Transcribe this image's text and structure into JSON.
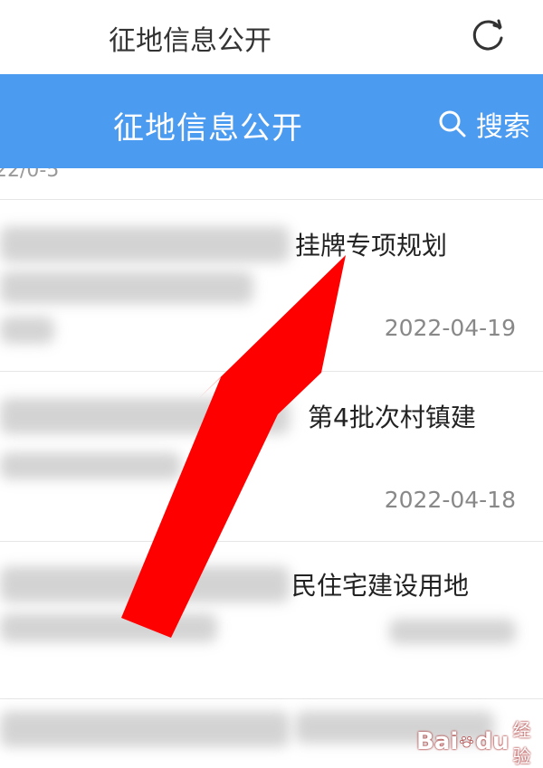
{
  "top": {
    "title": "征地信息公开",
    "refresh_icon": "refresh-icon"
  },
  "header": {
    "title": "征地信息公开",
    "search_label": "搜索",
    "accent": "#4b9bf0"
  },
  "list": {
    "partial_date": "22/0-5",
    "items": [
      {
        "title": "挂牌专项规划",
        "date": "2022-04-19"
      },
      {
        "title": "第4批次村镇建",
        "date": "2022-04-18"
      },
      {
        "title": "民住宅建设用地",
        "date": "2022-04-18"
      }
    ]
  },
  "annotation": {
    "arrow_color": "#ff0000"
  },
  "watermark": {
    "logo": "Bai",
    "logo_suffix": "du",
    "text": "经验"
  }
}
